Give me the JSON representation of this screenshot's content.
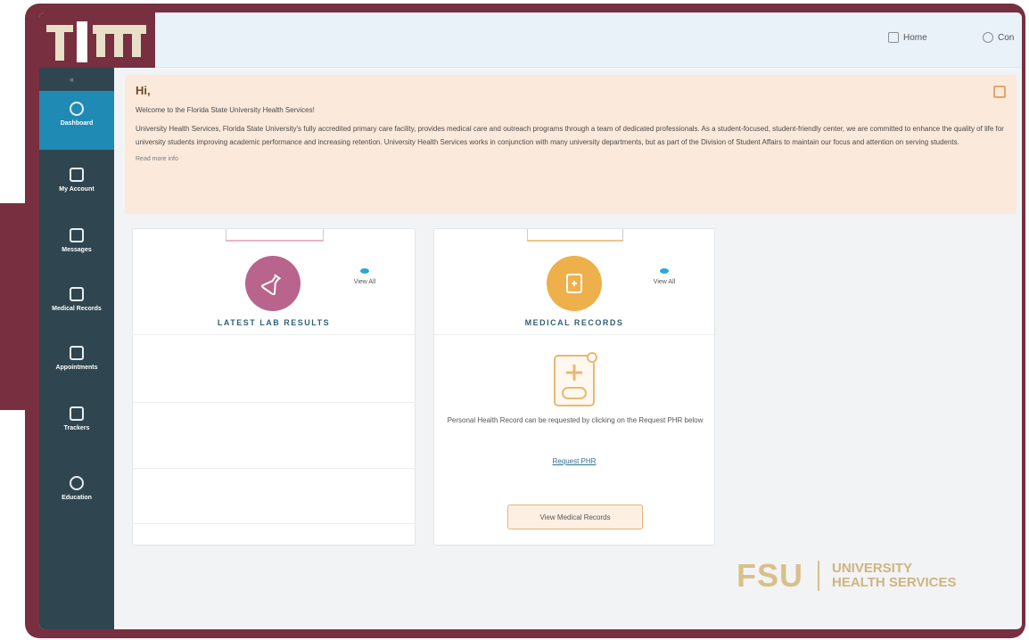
{
  "topbar": {
    "home_label": "Home",
    "contact_label": "Con"
  },
  "sidebar": {
    "collapse_glyph": "«",
    "items": [
      {
        "label": "Dashboard",
        "icon": "dashboard-icon"
      },
      {
        "label": "My Account",
        "icon": "account-icon"
      },
      {
        "label": "Messages",
        "icon": "messages-icon"
      },
      {
        "label": "Medical Records",
        "icon": "medical-records-icon"
      },
      {
        "label": "Appointments",
        "icon": "appointments-icon"
      },
      {
        "label": "Trackers",
        "icon": "trackers-icon"
      },
      {
        "label": "Education",
        "icon": "education-icon"
      }
    ]
  },
  "banner": {
    "greeting": "Hi,",
    "welcome": "Welcome to the Florida State University Health Services!",
    "about": "University Health Services, Florida State University's fully accredited primary care facility, provides medical care and outreach programs through a team of dedicated professionals. As a student-focused, student-friendly center, we are committed to enhance the quality of life for university students improving academic performance and increasing retention. University Health Services works in conjunction with many university departments, but as part of the Division of Student Affairs to maintain our focus and attention on serving students.",
    "more_link": "Read more info"
  },
  "lab_card": {
    "title": "LATEST LAB RESULTS",
    "view_all": "View All"
  },
  "records_card": {
    "title": "MEDICAL RECORDS",
    "view_all": "View All",
    "text": "Personal Health Record can be requested by clicking on the Request PHR below",
    "request_link": "Request PHR",
    "button": "View Medical Records"
  },
  "brand": {
    "fsu": "FSU",
    "line1": "UNIVERSITY",
    "line2": "HEALTH SERVICES"
  },
  "colors": {
    "garnet": "#782f40",
    "sidebar": "#2f4650",
    "active": "#1f8ab4",
    "banner": "#fbe9db",
    "gold": "#d8c08a",
    "lab_circle": "#b8648c",
    "records_circle": "#eeb04a"
  }
}
